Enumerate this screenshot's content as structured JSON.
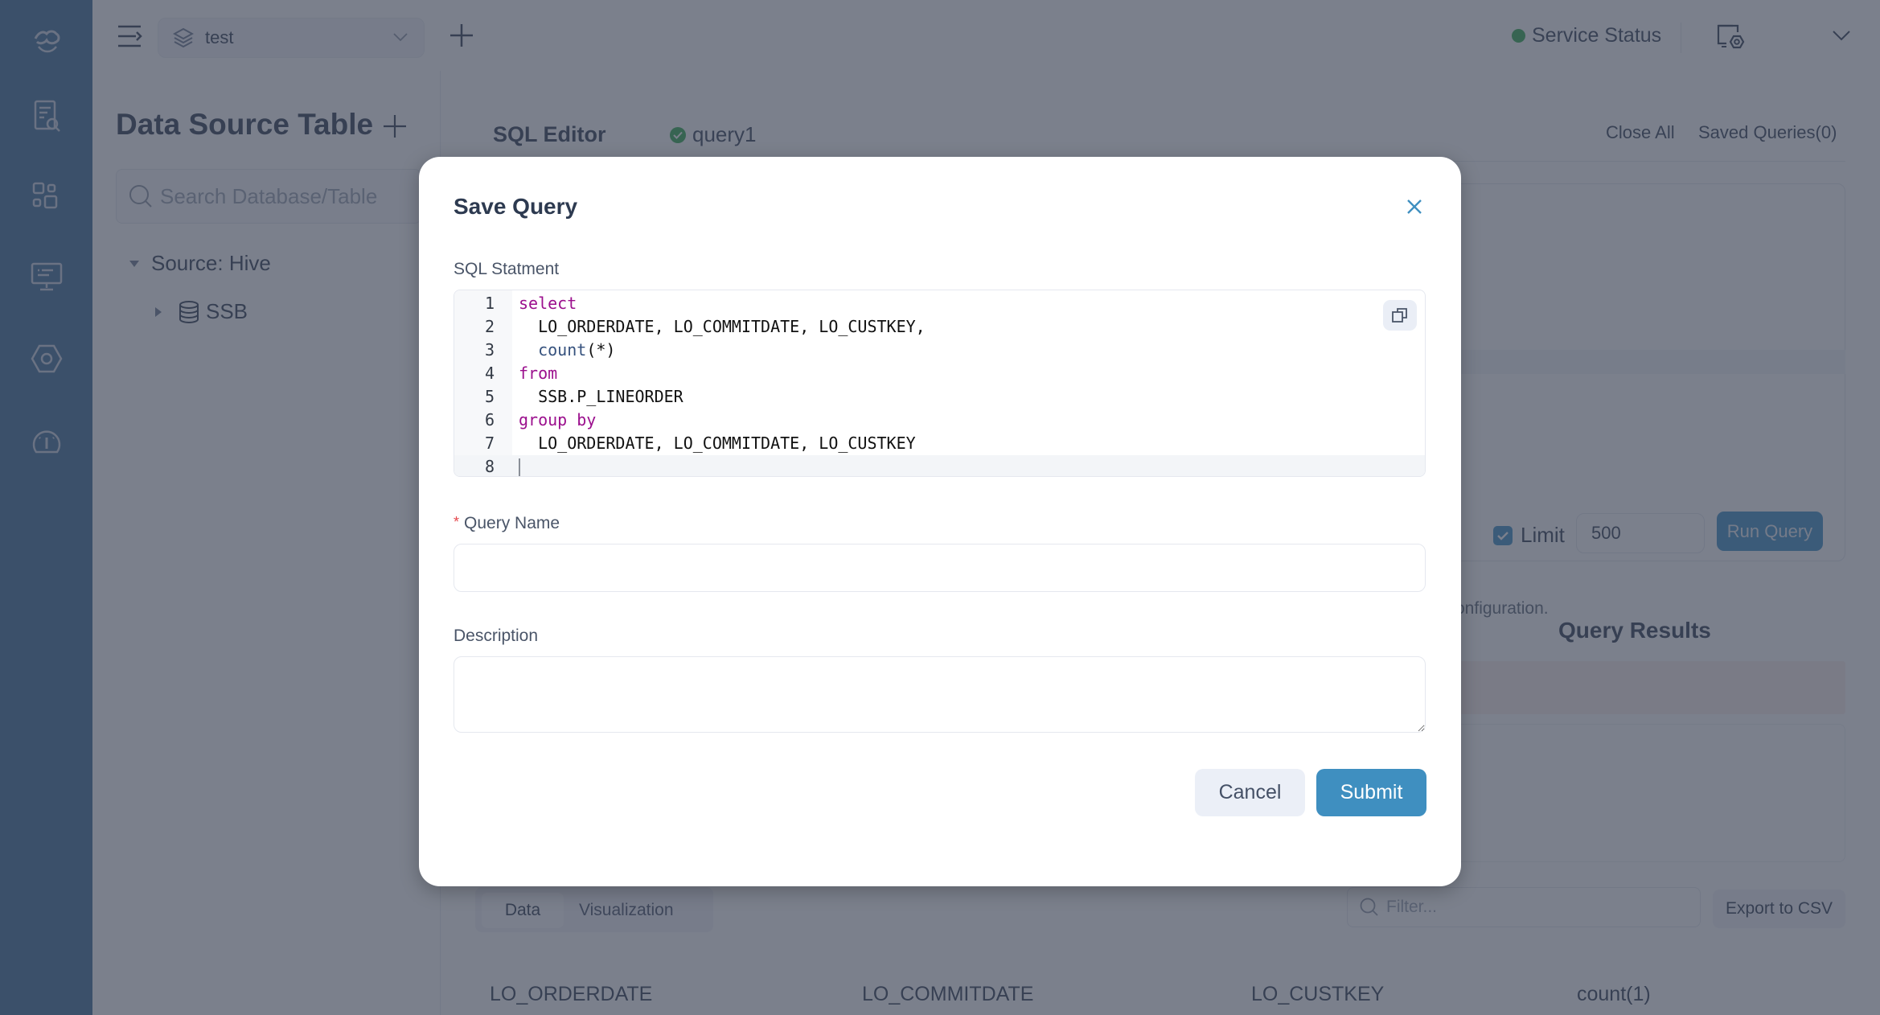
{
  "topbar": {
    "workspace": "test",
    "service_status": "Service Status",
    "status_color": "#2ea84b"
  },
  "sidebar": {
    "items": [
      {
        "icon": "logo-icon"
      },
      {
        "icon": "query-document-icon"
      },
      {
        "icon": "dashboard-icon"
      },
      {
        "icon": "monitor-icon"
      },
      {
        "icon": "settings-hex-icon"
      },
      {
        "icon": "gauge-icon"
      }
    ]
  },
  "left_panel": {
    "title": "Data Source Table",
    "search_placeholder": "Search Database/Table",
    "tree": {
      "source": "Source: Hive",
      "database": "SSB"
    }
  },
  "editor_header": {
    "title": "SQL Editor",
    "active_tab": "query1",
    "close_all": "Close All",
    "saved_queries": "Saved Queries(0)"
  },
  "run_controls": {
    "limit_label": "Limit",
    "limit_checked": true,
    "limit_value": "500",
    "run_label": "Run Query"
  },
  "results": {
    "config_hint": "onfiguration.",
    "title": "Query Results",
    "tabs": [
      "Data",
      "Visualization"
    ],
    "filter_placeholder": "Filter...",
    "export_label": "Export to CSV",
    "columns": [
      "LO_ORDERDATE",
      "LO_COMMITDATE",
      "LO_CUSTKEY",
      "count(1)"
    ]
  },
  "modal": {
    "title": "Save Query",
    "sql_label": "SQL Statment",
    "sql_lines": [
      {
        "n": "1",
        "parts": [
          {
            "t": "select",
            "c": "kw"
          }
        ]
      },
      {
        "n": "2",
        "parts": [
          {
            "t": "  LO_ORDERDATE, LO_COMMITDATE, LO_CUSTKEY,",
            "c": ""
          }
        ]
      },
      {
        "n": "3",
        "parts": [
          {
            "t": "  ",
            "c": ""
          },
          {
            "t": "count",
            "c": "fn"
          },
          {
            "t": "(*)",
            "c": ""
          }
        ]
      },
      {
        "n": "4",
        "parts": [
          {
            "t": "from",
            "c": "kw"
          }
        ]
      },
      {
        "n": "5",
        "parts": [
          {
            "t": "  SSB.P_LINEORDER",
            "c": ""
          }
        ]
      },
      {
        "n": "6",
        "parts": [
          {
            "t": "group by",
            "c": "kw"
          }
        ]
      },
      {
        "n": "7",
        "parts": [
          {
            "t": "  LO_ORDERDATE, LO_COMMITDATE, LO_CUSTKEY",
            "c": ""
          }
        ]
      },
      {
        "n": "8",
        "parts": []
      }
    ],
    "name_label": "Query Name",
    "name_required_mark": "*",
    "name_value": "",
    "description_label": "Description",
    "description_value": "",
    "cancel_label": "Cancel",
    "submit_label": "Submit",
    "accent_color": "#3f8fc0"
  }
}
